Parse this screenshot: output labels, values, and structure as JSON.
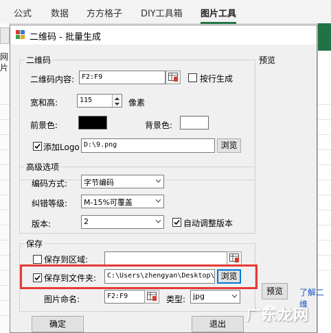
{
  "ribbon": {
    "tabs": [
      {
        "label": "公式"
      },
      {
        "label": "数据"
      },
      {
        "label": "方方格子"
      },
      {
        "label": "DIY工具箱"
      },
      {
        "label": "图片工具",
        "active": true
      }
    ],
    "accent": "#217346"
  },
  "left_strip": {
    "chars": [
      "网",
      "片"
    ]
  },
  "dialog": {
    "title": "二维码 - 批量生成",
    "qr_group": {
      "title": "二维码",
      "content_label": "二维码内容:",
      "content_value": "F2:F9",
      "row_gen_label": "按行生成",
      "row_gen_checked": false,
      "size_label": "宽和高:",
      "size_value": "115",
      "size_unit": "像素",
      "fg_label": "前景色:",
      "fg_color": "#000000",
      "bg_label": "背景色:",
      "bg_color": "#ffffff",
      "logo_label": "添加Logo",
      "logo_checked": true,
      "logo_path": "D:\\9.png",
      "browse_label": "浏览"
    },
    "adv_group": {
      "title": "高级选项",
      "encoding_label": "编码方式:",
      "encoding_value": "字节编码",
      "ecc_label": "纠错等级:",
      "ecc_value": "M-15%可覆盖",
      "version_label": "版本:",
      "version_value": "2",
      "auto_version_label": "自动调整版本",
      "auto_version_checked": true
    },
    "save_group": {
      "title": "保存",
      "to_range_label": "保存到区域:",
      "to_range_checked": false,
      "to_range_value": "",
      "to_folder_label": "保存到文件夹:",
      "to_folder_checked": true,
      "to_folder_value": "C:\\Users\\zhengyan\\Desktop\\",
      "browse_label": "浏览",
      "name_label": "图片命名:",
      "name_value": "F2:F9",
      "type_label": "类型:",
      "type_value": "jpg"
    },
    "preview": {
      "title": "预览",
      "button_label": "预览",
      "link_text": "了解二维"
    },
    "ok_label": "确定",
    "exit_label": "退出"
  },
  "watermark": {
    "text": "广东龙网"
  },
  "colors": {
    "highlight": "#e53935",
    "link": "#1a56c4"
  }
}
